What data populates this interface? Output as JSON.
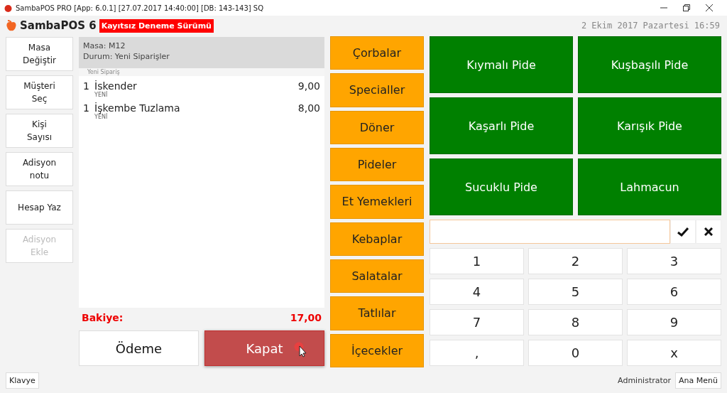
{
  "window": {
    "title": "SambaPOS PRO [App: 6.0.1] [27.07.2017 14:40:00] [DB: 143-143] SQ"
  },
  "header": {
    "logo": "SambaPOS 6",
    "badge": "Kayıtsız Deneme Sürümü",
    "datetime": "2 Ekim 2017 Pazartesi 16:59"
  },
  "actions": [
    {
      "label": "Masa\nDeğiştir",
      "disabled": false
    },
    {
      "label": "Müşteri\nSeç",
      "disabled": false
    },
    {
      "label": "Kişi\nSayısı",
      "disabled": false
    },
    {
      "label": "Adisyon\nnotu",
      "disabled": false
    },
    {
      "label": "Hesap Yaz",
      "disabled": false
    },
    {
      "label": "Adisyon\nEkle",
      "disabled": true
    }
  ],
  "ticket": {
    "table": "Masa: M12",
    "status": "Durum: Yeni Siparişler",
    "group": "Yeni Sipariş",
    "orders": [
      {
        "qty": "1",
        "name": "İskender",
        "tag": "YENİ",
        "price": "9,00"
      },
      {
        "qty": "1",
        "name": "İşkembe Tuzlama",
        "tag": "YENİ",
        "price": "8,00"
      }
    ],
    "balance_label": "Bakiye:",
    "balance": "17,00"
  },
  "buttons": [
    {
      "label": "Ödeme",
      "kind": "plain"
    },
    {
      "label": "Kapat",
      "kind": "danger"
    }
  ],
  "categories": [
    "Çorbalar",
    "Specialler",
    "Döner",
    "Pideler",
    "Et Yemekleri",
    "Kebaplar",
    "Salatalar",
    "Tatlılar",
    "İçecekler"
  ],
  "products": [
    "Kıymalı Pide",
    "Kuşbaşılı Pide",
    "Kaşarlı Pide",
    "Karışık Pide",
    "Sucuklu Pide",
    "Lahmacun"
  ],
  "numpad": [
    "1",
    "2",
    "3",
    "4",
    "5",
    "6",
    "7",
    "8",
    "9",
    ",",
    "0",
    "x"
  ],
  "footer": {
    "keyboard": "Klavye",
    "user": "Administrator",
    "menu": "Ana Menü"
  }
}
